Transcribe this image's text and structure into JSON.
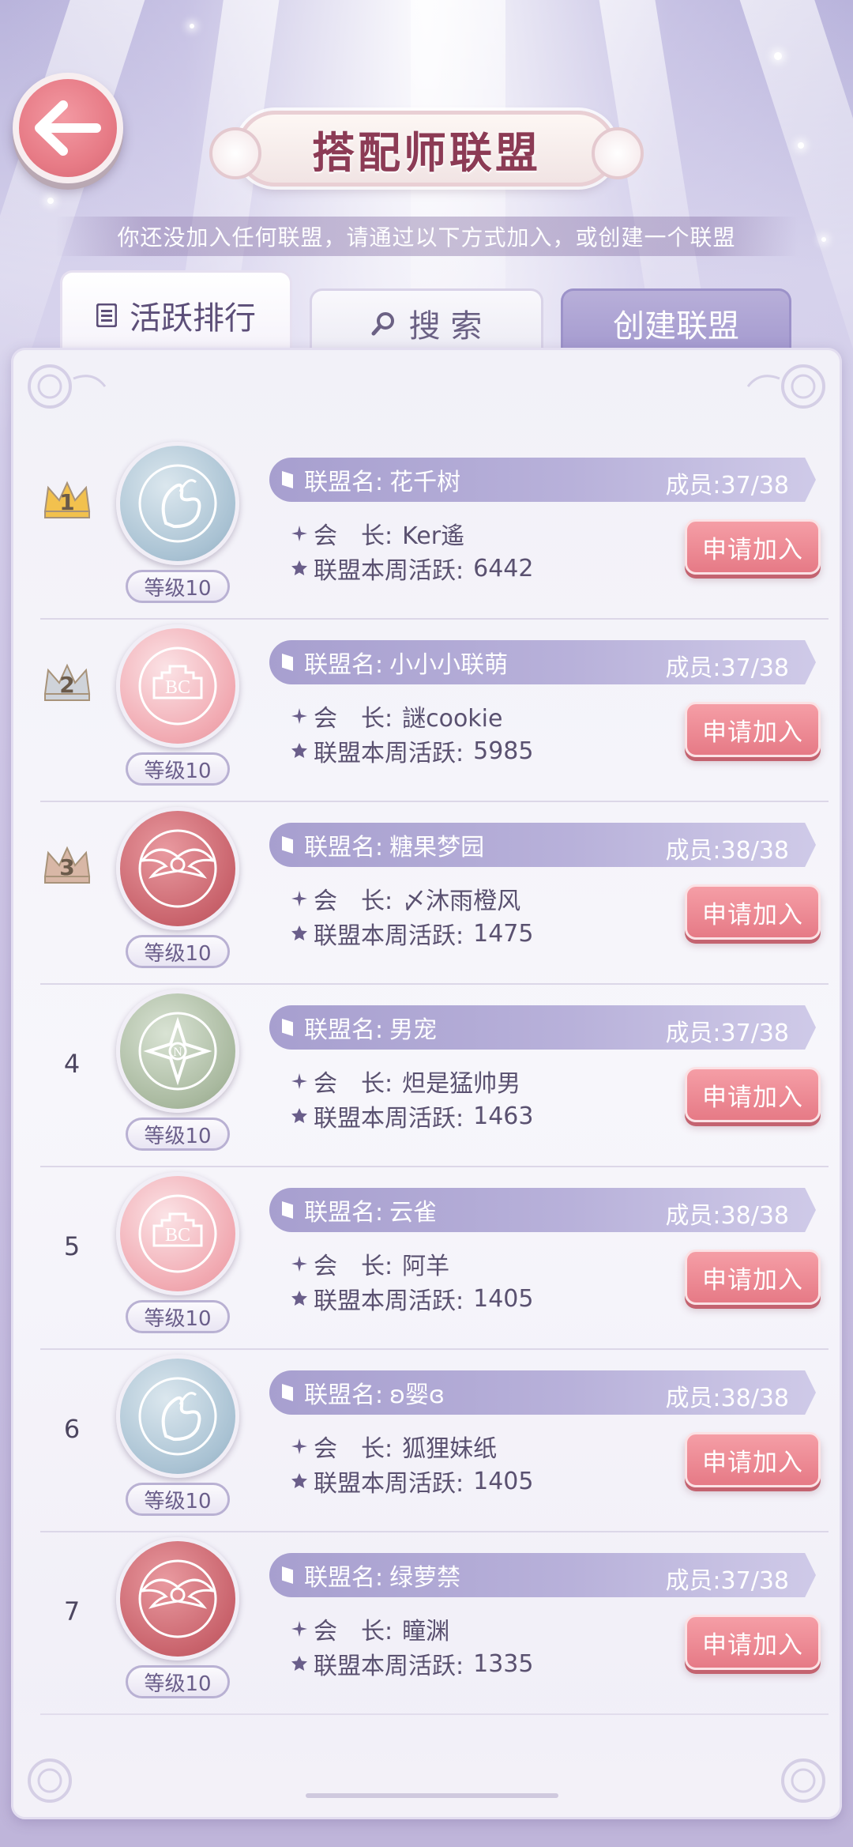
{
  "header": {
    "title": "搭配师联盟",
    "subtitle": "你还没加入任何联盟，请通过以下方式加入，或创建一个联盟"
  },
  "tabs": {
    "ranking": "活跃排行",
    "search": "搜 索",
    "create": "创建联盟"
  },
  "labels": {
    "name": "联盟名:",
    "members_prefix": "成员:",
    "leader": "会　长:",
    "activity": "联盟本周活跃:",
    "join": "申请加入"
  },
  "alliances": [
    {
      "rank": "1",
      "emblem": "swan-emblem",
      "level": "等级10",
      "name": "花千树",
      "members": "成员:37/38",
      "leader": "Ker遙",
      "activity": "6442"
    },
    {
      "rank": "2",
      "emblem": "castle-emblem",
      "level": "等级10",
      "name": "小小小联萌",
      "members": "成员:37/38",
      "leader": "謎cookie",
      "activity": "5985"
    },
    {
      "rank": "3",
      "emblem": "winged-emblem",
      "level": "等级10",
      "name": "糖果梦园",
      "members": "成员:38/38",
      "leader": "〆沐雨橙风",
      "activity": "1475"
    },
    {
      "rank": "4",
      "emblem": "cross-emblem",
      "level": "等级10",
      "name": "男宠",
      "members": "成员:37/38",
      "leader": "炟是猛帅男",
      "activity": "1463"
    },
    {
      "rank": "5",
      "emblem": "castle-emblem",
      "level": "等级10",
      "name": "云雀",
      "members": "成员:38/38",
      "leader": "阿羊",
      "activity": "1405"
    },
    {
      "rank": "6",
      "emblem": "swan-emblem",
      "level": "等级10",
      "name": "ʚ婴ɞ",
      "members": "成员:38/38",
      "leader": "狐狸妹纸",
      "activity": "1405"
    },
    {
      "rank": "7",
      "emblem": "winged-emblem",
      "level": "等级10",
      "name": "绿萝禁",
      "members": "成员:37/38",
      "leader": "瞳渊",
      "activity": "1335"
    }
  ],
  "colors": {
    "accent_pink": "#e67a86",
    "bar_purple": "#a79fcf",
    "crown_gold": "#f2c14e",
    "crown_silver": "#cfd3da",
    "crown_bronze": "#d8b7a6"
  },
  "icons": {
    "back": "left-arrow-icon",
    "ranking_tab": "list-icon",
    "search_tab": "magnifier-icon"
  }
}
